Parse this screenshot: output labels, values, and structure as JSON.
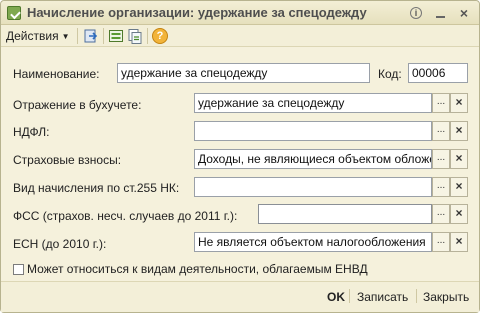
{
  "window": {
    "title": "Начисление организации: удержание за спецодежду"
  },
  "toolbar": {
    "actions_label": "Действия"
  },
  "form": {
    "name_label": "Наименование:",
    "name_value": "удержание за спецодежду",
    "code_label": "Код:",
    "code_value": "00006",
    "accounting_label": "Отражение в бухучете:",
    "accounting_value": "удержание за спецодежду",
    "ndfl_label": "НДФЛ:",
    "ndfl_value": "",
    "insurance_label": "Страховые взносы:",
    "insurance_value": "Доходы, не являющиеся объектом обложе",
    "accrual_label": "Вид начисления по ст.255 НК:",
    "accrual_value": "",
    "fss_label": "ФСС (страхов. несч. случаев до 2011 г.):",
    "fss_value": "",
    "esn_label": "ЕСН (до 2010 г.):",
    "esn_value": "Не является объектом налогообложения",
    "envd_label": "Может относиться к видам деятельности, облагаемым  ЕНВД",
    "envd_checked": false
  },
  "footer": {
    "ok_label": "OK",
    "save_label": "Записать",
    "close_label": "Закрыть"
  },
  "buttons": {
    "select": "...",
    "clear": "×"
  }
}
